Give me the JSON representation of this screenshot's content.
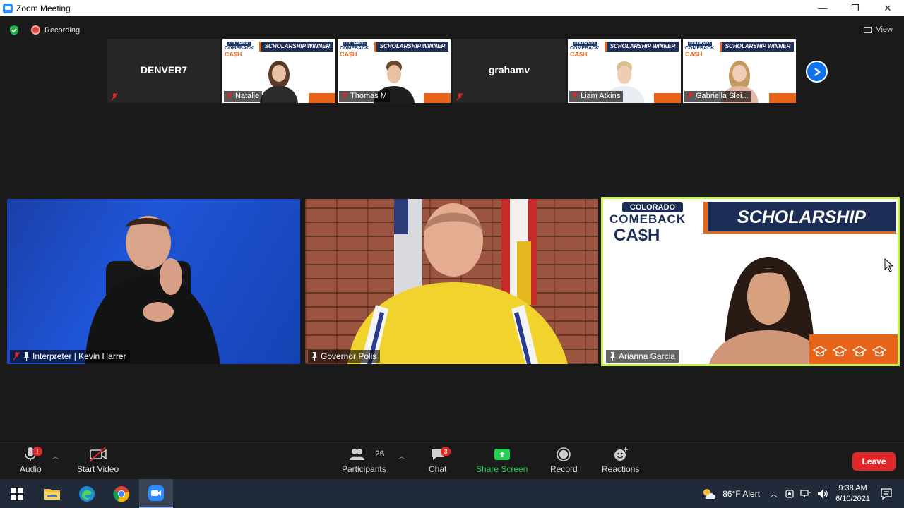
{
  "window": {
    "title": "Zoom Meeting",
    "minimize": "—",
    "restore": "❐",
    "close": "✕"
  },
  "status": {
    "recording_label": "Recording",
    "view_label": "View"
  },
  "strip": {
    "items": [
      {
        "type": "name",
        "name": "DENVER7"
      },
      {
        "type": "video",
        "banner": "SCHOLARSHIP WINNER",
        "name": "Natalie"
      },
      {
        "type": "video",
        "banner": "SCHOLARSHIP WINNER",
        "name": "Thomas M"
      },
      {
        "type": "name",
        "name": "grahamv"
      },
      {
        "type": "video",
        "banner": "SCHOLARSHIP WINNER",
        "name": "Liam Atkins"
      },
      {
        "type": "video",
        "banner": "SCHOLARSHIP WINNER",
        "name": "Gabriella Slei..."
      }
    ],
    "logo_top": "COLORADO",
    "logo_mid": "COMEBACK",
    "logo_bottom": "CA$H"
  },
  "tiles": {
    "interpreter": {
      "name": "Interpreter |  Kevin Harrer"
    },
    "polis": {
      "name": "Governor Polis"
    },
    "arianna": {
      "name": "Arianna Garcia",
      "banner": "SCHOLARSHIP WINNER",
      "logo_top": "COLORADO",
      "logo_mid": "COMEBACK",
      "logo_bottom": "CA$H"
    }
  },
  "toolbar": {
    "audio": "Audio",
    "audio_badge": "!",
    "start_video": "Start Video",
    "participants": "Participants",
    "participants_count": "26",
    "chat": "Chat",
    "chat_badge": "3",
    "share_screen": "Share Screen",
    "record": "Record",
    "reactions": "Reactions",
    "leave": "Leave"
  },
  "taskbar": {
    "weather": "86°F  Alert",
    "time": "9:38 AM",
    "date": "6/10/2021"
  },
  "colors": {
    "accent": "#0e72ed",
    "leave": "#e02828",
    "share": "#24d153",
    "active_speaker": "#c6f548",
    "banner_navy": "#1b2c55",
    "banner_orange": "#e8641b"
  }
}
